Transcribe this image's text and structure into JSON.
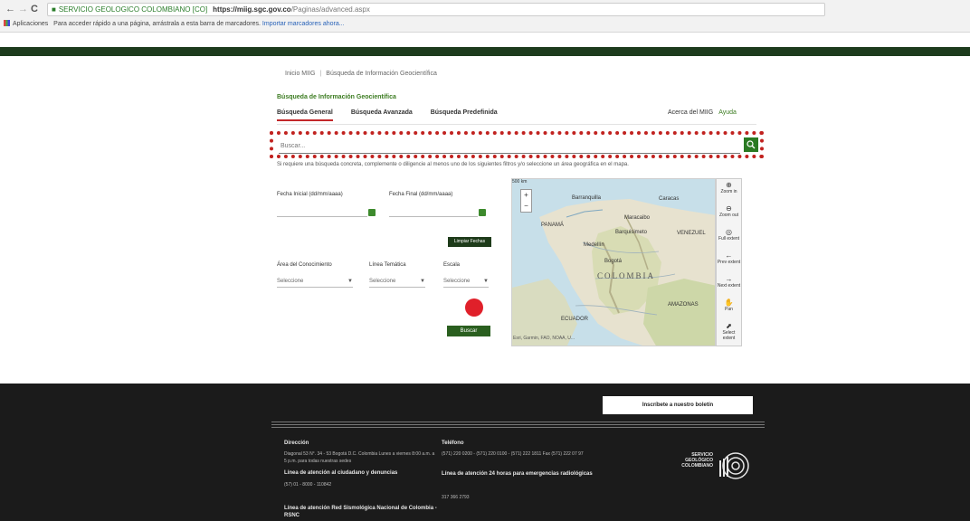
{
  "browser": {
    "back": "←",
    "forward": "→",
    "reload": "C",
    "site_name": "SERVICIO GEOLOGICO COLOMBIANO [CO]",
    "url_host": "https://miig.sgc.gov.co",
    "url_path": "/Paginas/advanced.aspx",
    "apps_label": "Aplicaciones",
    "bookmarks_hint": "Para acceder rápido a una página, arrástrala a esta barra de marcadores.",
    "bookmarks_link": "Importar marcadores ahora..."
  },
  "breadcrumb": {
    "home": "Inicio MIIG",
    "current": "Búsqueda de Información Geocientífica"
  },
  "section_title": "Búsqueda de Información Geocientífica",
  "tabs": [
    {
      "label": "Búsqueda General"
    },
    {
      "label": "Búsqueda Avanzada"
    },
    {
      "label": "Búsqueda Predefinida"
    }
  ],
  "links": {
    "about": "Acerca del MIIG",
    "help": "Ayuda"
  },
  "search": {
    "placeholder": "Buscar..."
  },
  "hint": "Si requiere una búsqueda concreta, complemente o diligencie al menos uno de los siguientes filtros y/o seleccione un área geográfica en el mapa.",
  "filters": {
    "start_date_label": "Fecha Inicial (dd/mm/aaaa)",
    "end_date_label": "Fecha Final (dd/mm/aaaa)",
    "clear_dates": "Limpiar Fechas",
    "area_label": "Área del Conocimiento",
    "line_label": "Línea Temática",
    "scale_label": "Escala",
    "select_placeholder": "Seleccione",
    "search_button": "Buscar"
  },
  "map": {
    "scale": "500 km",
    "country": "COLOMBIA",
    "labels": [
      "Barranquilla",
      "Caracas",
      "Maracaibo",
      "Barquisimeto",
      "Medellín",
      "Bogotá",
      "PANAMÁ",
      "VENEZUEL",
      "ECUADOR",
      "AMAZONAS"
    ],
    "attribution": "Esri, Garmin, FAO, NOAA, U...",
    "tools": [
      {
        "icon": "⊕",
        "label": "Zoom in"
      },
      {
        "icon": "⊖",
        "label": "Zoom out"
      },
      {
        "icon": "◎",
        "label": "Full extent"
      },
      {
        "icon": "←",
        "label": "Prev extent"
      },
      {
        "icon": "→",
        "label": "Next extent"
      },
      {
        "icon": "✋",
        "label": "Pan"
      },
      {
        "icon": "⬈",
        "label": "Select extent"
      }
    ]
  },
  "footer": {
    "subscribe": "Inscríbete a nuestro boletín",
    "address_title": "Dirección",
    "address_text": "Diagonal 53 N°. 34 - 53 Bogotá D.C. Colombia Lunes a viernes 8:00 a.m. a 5 p.m. para todas nuestras sedes",
    "citizen_title": "Línea de atención al ciudadano y denuncias",
    "citizen_phone": "(57) 01 - 8000 - 110842",
    "seismic_title": "Línea de atención Red Sismológica Nacional de Colombia - RSNC",
    "phone_title": "Teléfono",
    "phone_text": "(571) 220 0200 - (571) 220 0100 - (571) 222 1811 Fax (571) 222 07 97",
    "radiology_title": "Línea de atención 24 horas para emergencias radiológicas",
    "radiology_phone": "317 366 2793",
    "org_name": "SERVICIO GEOLÓGICO COLOMBIANO"
  }
}
